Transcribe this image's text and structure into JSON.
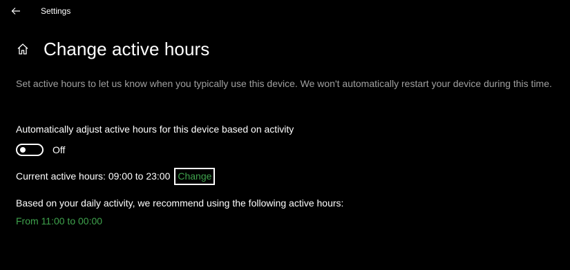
{
  "window": {
    "title": "Settings"
  },
  "icons": {
    "back": "back-arrow-icon",
    "home": "home-icon"
  },
  "page": {
    "title": "Change active hours",
    "description": "Set active hours to let us know when you typically use this device. We won't automatically restart your device during this time."
  },
  "auto_adjust": {
    "label": "Automatically adjust active hours for this device based on activity",
    "toggle_on": false,
    "state_label": "Off"
  },
  "current_hours": {
    "label": "Current active hours: 09:00 to 23:00",
    "change_link": "Change"
  },
  "recommendation": {
    "label": "Based on your daily activity, we recommend using the following active hours:",
    "link": "From 11:00 to 00:00"
  },
  "colors": {
    "background": "#000000",
    "text": "#ffffff",
    "secondary_text": "#a0a0a0",
    "accent_link": "#3fa34d"
  }
}
